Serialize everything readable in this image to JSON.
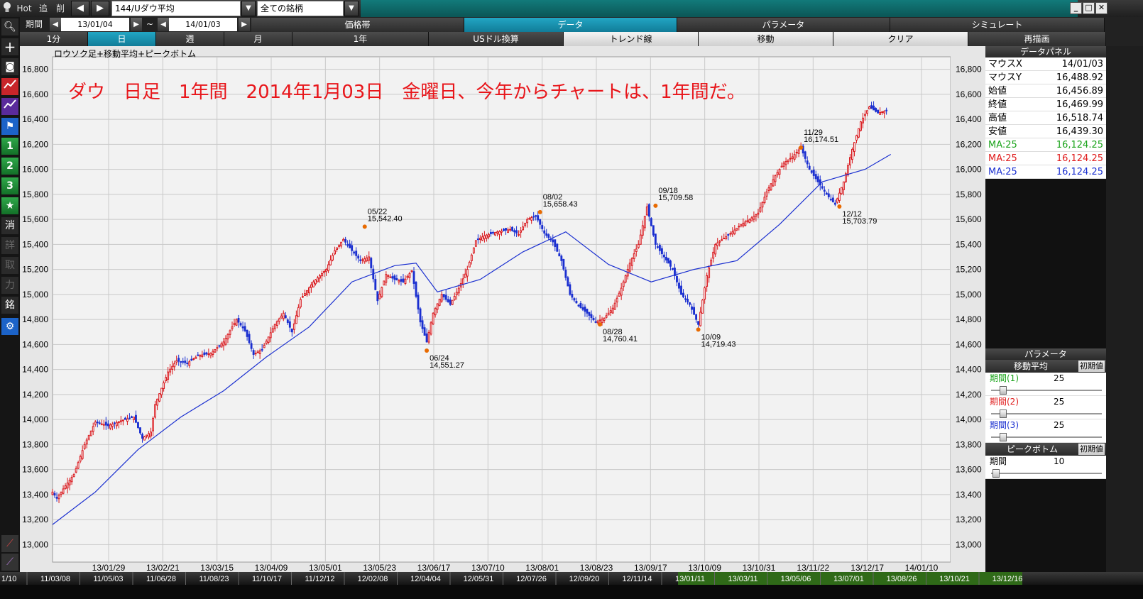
{
  "topbar": {
    "hot_label": "Hot",
    "add_label": "追",
    "del_label": "削",
    "symbol": "144/Uダウ平均",
    "filter": "全ての銘柄"
  },
  "row2": {
    "period_label": "期間",
    "start_date": "13/01/04",
    "tilde": "~",
    "end_date": "14/01/03",
    "tabs": [
      "価格帯",
      "データ",
      "パラメータ",
      "シミュレート"
    ]
  },
  "row3": {
    "tabs": [
      "1分",
      "日",
      "週",
      "月",
      "1年",
      "USドル換算",
      "トレンド線",
      "移動",
      "クリア",
      "再描画"
    ]
  },
  "sidebar": {
    "items": [
      "1",
      "2",
      "3",
      "消",
      "詳",
      "取",
      "力",
      "銘"
    ]
  },
  "chart": {
    "header": "ロウソク足+移動平均+ピークボトム",
    "annotation": "ダウ　日足　1年間　2014年1月03日　金曜日、今年からチャートは、1年間だ。"
  },
  "chart_data": {
    "type": "candlestick",
    "title": "",
    "xlabel": "",
    "ylabel": "",
    "ylim": [
      12860,
      16900
    ],
    "y_ticks": [
      13000,
      13200,
      13400,
      13600,
      13800,
      14000,
      14200,
      14400,
      14600,
      14800,
      15000,
      15200,
      15400,
      15600,
      15800,
      16000,
      16200,
      16400,
      16600,
      16800
    ],
    "y_tick_labels": [
      "13,000",
      "13,200",
      "13,400",
      "13,600",
      "13,800",
      "14,000",
      "14,200",
      "14,400",
      "14,600",
      "14,800",
      "15,000",
      "15,200",
      "15,400",
      "15,600",
      "15,800",
      "16,000",
      "16,200",
      "16,400",
      "16,600",
      "16,800"
    ],
    "x_tick_labels": [
      "13/01/29",
      "13/02/21",
      "13/03/15",
      "13/04/09",
      "13/05/01",
      "13/05/23",
      "13/06/17",
      "13/07/10",
      "13/08/01",
      "13/08/23",
      "13/09/17",
      "13/10/09",
      "13/10/31",
      "13/11/22",
      "13/12/17",
      "14/01/10"
    ],
    "grid": true,
    "close_path": [
      [
        0,
        13420
      ],
      [
        2,
        13370
      ],
      [
        6,
        13470
      ],
      [
        10,
        13560
      ],
      [
        15,
        13800
      ],
      [
        20,
        13980
      ],
      [
        26,
        13950
      ],
      [
        32,
        13990
      ],
      [
        38,
        14020
      ],
      [
        42,
        13850
      ],
      [
        46,
        13900
      ],
      [
        48,
        14120
      ],
      [
        54,
        14380
      ],
      [
        58,
        14470
      ],
      [
        63,
        14450
      ],
      [
        68,
        14510
      ],
      [
        74,
        14530
      ],
      [
        80,
        14620
      ],
      [
        86,
        14800
      ],
      [
        90,
        14710
      ],
      [
        94,
        14520
      ],
      [
        98,
        14560
      ],
      [
        104,
        14760
      ],
      [
        108,
        14850
      ],
      [
        112,
        14700
      ],
      [
        116,
        14960
      ],
      [
        122,
        15100
      ],
      [
        128,
        15200
      ],
      [
        132,
        15350
      ],
      [
        136,
        15440
      ],
      [
        140,
        15350
      ],
      [
        144,
        15270
      ],
      [
        148,
        15300
      ],
      [
        152,
        14950
      ],
      [
        156,
        15160
      ],
      [
        160,
        15120
      ],
      [
        164,
        15100
      ],
      [
        168,
        15190
      ],
      [
        172,
        14780
      ],
      [
        175,
        14620
      ],
      [
        178,
        14850
      ],
      [
        182,
        15000
      ],
      [
        186,
        14920
      ],
      [
        190,
        15050
      ],
      [
        194,
        15200
      ],
      [
        198,
        15430
      ],
      [
        202,
        15470
      ],
      [
        208,
        15500
      ],
      [
        214,
        15520
      ],
      [
        218,
        15480
      ],
      [
        222,
        15600
      ],
      [
        226,
        15630
      ],
      [
        230,
        15490
      ],
      [
        234,
        15420
      ],
      [
        238,
        15270
      ],
      [
        242,
        15000
      ],
      [
        246,
        14910
      ],
      [
        250,
        14850
      ],
      [
        254,
        14780
      ],
      [
        258,
        14810
      ],
      [
        262,
        14890
      ],
      [
        266,
        15050
      ],
      [
        270,
        15250
      ],
      [
        274,
        15400
      ],
      [
        278,
        15700
      ],
      [
        282,
        15400
      ],
      [
        286,
        15300
      ],
      [
        290,
        15200
      ],
      [
        294,
        15000
      ],
      [
        298,
        14920
      ],
      [
        302,
        14760
      ],
      [
        306,
        15150
      ],
      [
        310,
        15400
      ],
      [
        314,
        15450
      ],
      [
        318,
        15500
      ],
      [
        322,
        15560
      ],
      [
        326,
        15600
      ],
      [
        330,
        15650
      ],
      [
        334,
        15820
      ],
      [
        338,
        15950
      ],
      [
        342,
        16050
      ],
      [
        346,
        16100
      ],
      [
        350,
        16174
      ],
      [
        354,
        16000
      ],
      [
        358,
        15900
      ],
      [
        362,
        15800
      ],
      [
        366,
        15720
      ],
      [
        370,
        15900
      ],
      [
        374,
        16160
      ],
      [
        378,
        16380
      ],
      [
        382,
        16500
      ],
      [
        386,
        16450
      ],
      [
        390,
        16470
      ]
    ],
    "ma_path": [
      [
        0,
        13160
      ],
      [
        20,
        13420
      ],
      [
        40,
        13760
      ],
      [
        60,
        14020
      ],
      [
        80,
        14230
      ],
      [
        100,
        14500
      ],
      [
        120,
        14740
      ],
      [
        140,
        15100
      ],
      [
        160,
        15230
      ],
      [
        170,
        15250
      ],
      [
        180,
        15020
      ],
      [
        200,
        15120
      ],
      [
        220,
        15340
      ],
      [
        240,
        15500
      ],
      [
        260,
        15240
      ],
      [
        280,
        15100
      ],
      [
        300,
        15200
      ],
      [
        320,
        15270
      ],
      [
        340,
        15560
      ],
      [
        360,
        15900
      ],
      [
        380,
        16000
      ],
      [
        392,
        16120
      ]
    ],
    "peaks": [
      {
        "x": 146,
        "date": "05/22",
        "value": "15,542.40",
        "y": 15542
      },
      {
        "x": 175,
        "date": "06/24",
        "value": "14,551.27",
        "y": 14551
      },
      {
        "x": 228,
        "date": "08/02",
        "value": "15,658.43",
        "y": 15658
      },
      {
        "x": 256,
        "date": "08/28",
        "value": "14,760.41",
        "y": 14760
      },
      {
        "x": 282,
        "date": "09/18",
        "value": "15,709.58",
        "y": 15709
      },
      {
        "x": 302,
        "date": "10/09",
        "value": "14,719.43",
        "y": 14719
      },
      {
        "x": 350,
        "date": "11/29",
        "value": "16,174.51",
        "y": 16174
      },
      {
        "x": 368,
        "date": "12/12",
        "value": "15,703.79",
        "y": 15703
      }
    ]
  },
  "data_panel": {
    "title": "データパネル",
    "rows": [
      {
        "label": "マウスX",
        "value": "14/01/03"
      },
      {
        "label": "マウスY",
        "value": "16,488.92"
      },
      {
        "label": "始値",
        "value": "16,456.89"
      },
      {
        "label": "終値",
        "value": "16,469.99"
      },
      {
        "label": "高値",
        "value": "16,518.74"
      },
      {
        "label": "安値",
        "value": "16,439.30"
      }
    ],
    "ma_rows": [
      {
        "label": "MA:25",
        "value": "16,124.25",
        "color": "#1aa31a"
      },
      {
        "label": "MA:25",
        "value": "16,124.25",
        "color": "#e01c1c"
      },
      {
        "label": "MA:25",
        "value": "16,124.25",
        "color": "#1a2fd0"
      }
    ]
  },
  "param_panel": {
    "title": "パラメータ",
    "ma_title": "移動平均",
    "init_label": "初期値",
    "ma_params": [
      {
        "label": "期間(1)",
        "value": "25",
        "color": "#1aa31a"
      },
      {
        "label": "期間(2)",
        "value": "25",
        "color": "#e01c1c"
      },
      {
        "label": "期間(3)",
        "value": "25",
        "color": "#1a2fd0"
      }
    ],
    "pb_title": "ピークボトム",
    "pb_param": {
      "label": "期間",
      "value": "10"
    }
  },
  "bottom_axis": {
    "labels": [
      "11/03/08",
      "11/05/03",
      "11/06/28",
      "11/08/23",
      "11/10/17",
      "11/12/12",
      "12/02/08",
      "12/04/04",
      "12/05/31",
      "12/07/26",
      "12/09/20",
      "12/11/14",
      "13/01/11",
      "13/03/11",
      "13/05/06",
      "13/07/01",
      "13/08/26",
      "13/10/21",
      "13/12/16"
    ],
    "first_label": "1/10"
  }
}
